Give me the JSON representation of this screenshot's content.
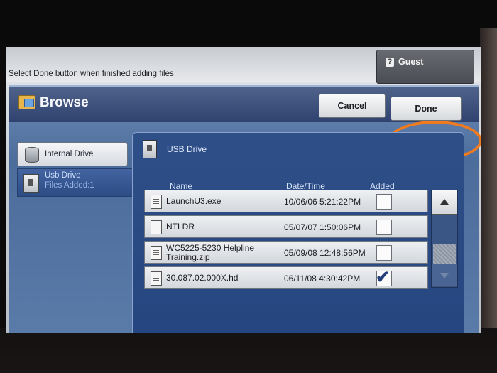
{
  "instruction": "Select Done button when finished adding files",
  "user": {
    "label": "Guest",
    "icon": "user-icon"
  },
  "window": {
    "title": "Browse",
    "icon": "folder-icon"
  },
  "buttons": {
    "cancel": "Cancel",
    "done": "Done"
  },
  "sidebar": {
    "items": [
      {
        "label": "Internal Drive",
        "icon": "hard-drive-icon",
        "selected": false
      },
      {
        "label": "Usb Drive",
        "sub": "Files Added:1",
        "icon": "usb-drive-icon",
        "selected": true
      }
    ]
  },
  "location": {
    "label": "USB Drive",
    "icon": "usb-drive-icon"
  },
  "table": {
    "headers": {
      "name": "Name",
      "date": "Date/Time",
      "added": "Added"
    },
    "rows": [
      {
        "name": "LaunchU3.exe",
        "date": "10/06/06 5:21:22PM",
        "added": false
      },
      {
        "name": "NTLDR",
        "date": "05/07/07 1:50:06PM",
        "added": false
      },
      {
        "name": "WC5225-5230 Helpline Training.zip",
        "date": "05/09/08 12:48:56PM",
        "added": false
      },
      {
        "name": "30.087.02.000X.hd",
        "date": "06/11/08 4:30:42PM",
        "added": true
      }
    ]
  },
  "highlight_color": "#f07a1e"
}
